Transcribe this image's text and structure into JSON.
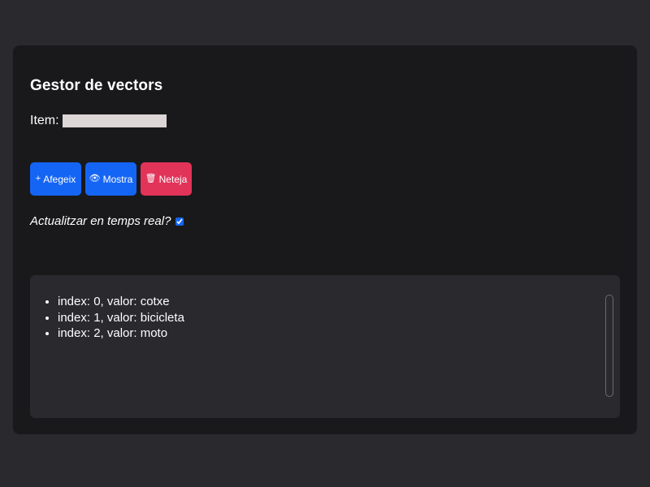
{
  "header": {
    "title": "Gestor de vectors"
  },
  "form": {
    "item_label": "Item:",
    "item_value": ""
  },
  "buttons": {
    "add_icon": "+",
    "add_label": "Afegeix",
    "show_icon": "👁",
    "show_label": "Mostra",
    "clear_icon": "🗑",
    "clear_label": "Neteja"
  },
  "realtime": {
    "label": "Actualitzar en temps real?",
    "checked": true
  },
  "output": {
    "items": [
      "index: 0, valor: cotxe",
      "index: 1, valor: bicicleta",
      "index: 2, valor: moto"
    ]
  },
  "colors": {
    "page_bg": "#29292e",
    "card_bg": "#19191b",
    "primary": "#1565f5",
    "danger": "#e23359",
    "input_bg": "#ddd6d6"
  }
}
